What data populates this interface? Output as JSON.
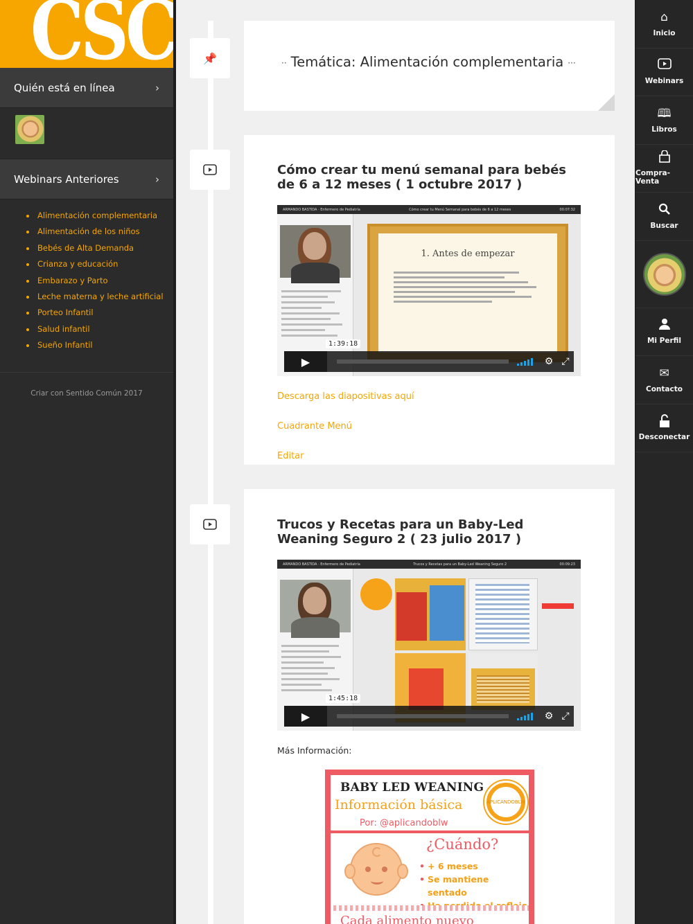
{
  "brand": {
    "logo_text": "CSC",
    "accent": "#f7a600"
  },
  "left_sidebar": {
    "online_panel": {
      "title": "Quién está en línea",
      "chevron": "chevron-right-icon"
    },
    "webinars_panel": {
      "title": "Webinars Anteriores",
      "chevron": "chevron-right-icon",
      "items": [
        "Alimentación complementaria",
        "Alimentación de los niños",
        "Bebés de Alta Demanda",
        "Crianza y educación",
        "Embarazo y Parto",
        "Leche materna y leche artificial",
        "Porteo Infantil",
        "Salud infantil",
        "Sueño Infantil"
      ]
    },
    "footer": "Criar con Sentido Común 2017"
  },
  "right_nav": {
    "items": [
      {
        "label": "Inicio",
        "icon": "home-icon"
      },
      {
        "label": "Webinars",
        "icon": "play-icon"
      },
      {
        "label": "Libros",
        "icon": "book-icon"
      },
      {
        "label": "Compra-Venta",
        "icon": "shopping-bag-icon"
      },
      {
        "label": "Buscar",
        "icon": "search-icon"
      },
      {
        "label": "Mi Perfil",
        "icon": "user-icon"
      },
      {
        "label": "Contacto",
        "icon": "envelope-icon"
      },
      {
        "label": "Desconectar",
        "icon": "unlock-icon"
      }
    ]
  },
  "pinned": {
    "prefix": "··",
    "title": "Temática: Alimentación complementaria",
    "suffix": "···",
    "icon": "pin-icon"
  },
  "posts": [
    {
      "icon": "video-icon",
      "title": "Cómo crear tu menú semanal para bebés de 6 a 12 meses ( 1 octubre 2017 )",
      "video": {
        "header_left": "ARMANDO BASTIDA · Enfermero de Pediatría",
        "header_center": "Cómo crear tu Menú Semanal para bebés de 6 a 12 meses",
        "header_right": "00:07:32",
        "slide_title": "1. Antes de empezar",
        "duration": "1:39:18"
      },
      "links": [
        "Descarga las diapositivas aquí",
        "Cuadrante Menú",
        "Editar"
      ]
    },
    {
      "icon": "video-icon",
      "title": "Trucos y Recetas para un Baby-Led Weaning Seguro 2 ( 23 julio 2017 )",
      "video": {
        "header_left": "ARMANDO BASTIDA · Enfermero de Pediatría",
        "header_center": "Trucos y Recetas para un Baby-Led Weaning Seguro 2",
        "header_right": "00:09:23",
        "duration": "1:45:18"
      },
      "more_info": "Más Información:",
      "infographic": {
        "title": "BABY LED WEANING",
        "subtitle": "Información básica",
        "by": "Por: @aplicandoblw",
        "badge": "APLICANDOBLW",
        "question": "¿Cuándo?",
        "bullets": [
          "+ 6 meses",
          "Se mantiene sentado",
          "Ha perdido el reflejo de extrusión"
        ],
        "bottom": "Cada alimento nuevo"
      }
    }
  ]
}
